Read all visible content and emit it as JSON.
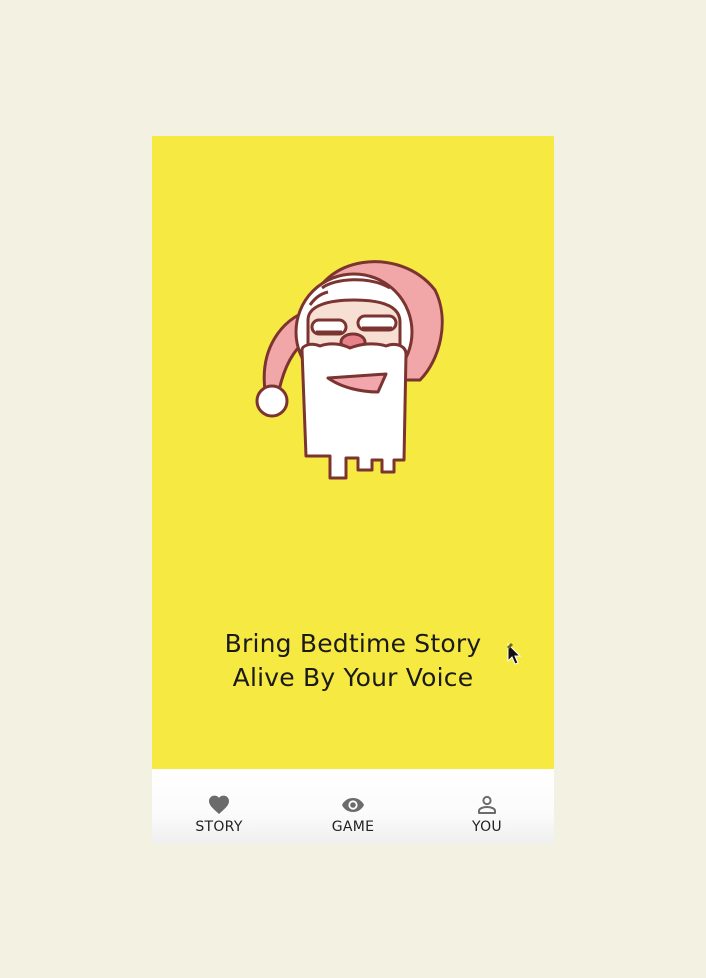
{
  "hero": {
    "tagline_line1": "Bring Bedtime Story",
    "tagline_line2": "Alive By Your Voice"
  },
  "tabs": [
    {
      "label": "STORY",
      "icon": "heart-icon"
    },
    {
      "label": "GAME",
      "icon": "eye-icon"
    },
    {
      "label": "YOU",
      "icon": "person-icon"
    }
  ],
  "colors": {
    "hero_background": "#f6e941",
    "page_background": "#f3f2e2",
    "tab_icon": "#6b6b6b"
  }
}
